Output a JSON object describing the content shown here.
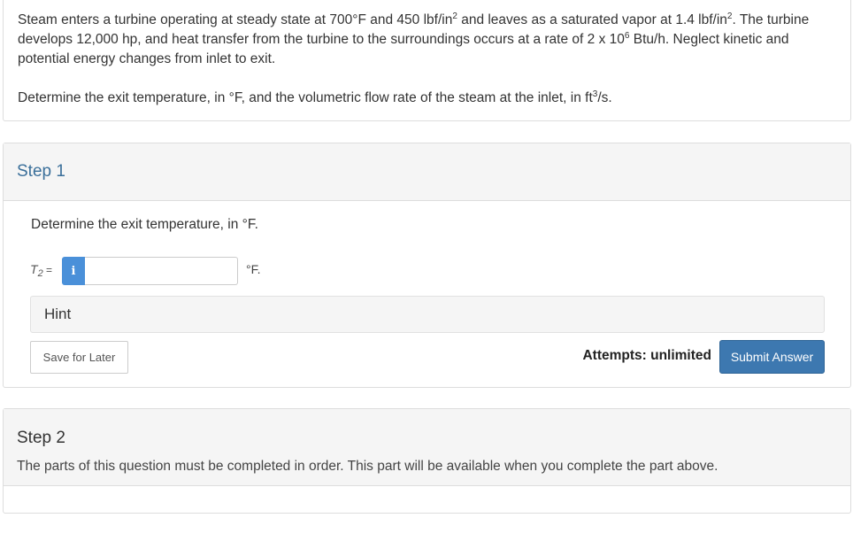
{
  "problem": {
    "p1": "Steam enters a turbine operating at steady state at 700°F and 450 lbf/in",
    "p1_sup": "2",
    "p2": " and leaves as a saturated vapor at 1.4 lbf/in",
    "p2_sup": "2",
    "p3": ". The turbine develops 12,000 hp, and heat transfer from the turbine to the surroundings occurs at a rate of 2 x 10",
    "p3_sup": "6",
    "p4": " Btu/h. Neglect kinetic and potential energy changes from inlet to exit.",
    "q1": "Determine the exit temperature, in °F, and the volumetric flow rate of the steam at the inlet, in ft",
    "q1_sup": "3",
    "q2": "/s."
  },
  "step1": {
    "title": "Step 1",
    "instruction": "Determine the exit temperature, in °F.",
    "var_letter": "T",
    "var_sub": "2",
    "var_eq": " =",
    "info_glyph": "i",
    "input_value": "",
    "unit": "°F.",
    "hint_label": "Hint",
    "save_label": "Save for Later",
    "attempts_text": "Attempts: unlimited",
    "submit_label": "Submit Answer"
  },
  "step2": {
    "title": "Step 2",
    "note": "The parts of this question must be completed in order. This part will be available when you complete the part above."
  },
  "colors": {
    "accent": "#3d78b0",
    "info": "#4a90d9",
    "step_title": "#3a6f9a",
    "panel_bg": "#f5f5f5"
  }
}
